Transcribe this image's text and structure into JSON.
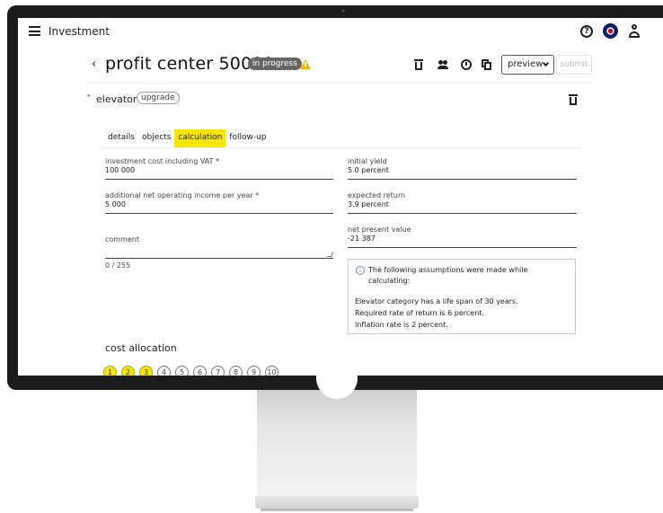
{
  "header": {
    "app_title": "Investment"
  },
  "page": {
    "title": "profit center 50009",
    "status": "in progress",
    "preview_label": "preview",
    "submit_label": "submit"
  },
  "section": {
    "title": "elevator",
    "badge": "upgrade"
  },
  "tabs": [
    {
      "label": "details"
    },
    {
      "label": "objects"
    },
    {
      "label": "calculation",
      "active": true
    },
    {
      "label": "follow-up"
    }
  ],
  "fields": {
    "investment_cost": {
      "label": "investment cost including VAT *",
      "value": "100 000"
    },
    "additional_income": {
      "label": "additional net operating income per year *",
      "value": "5 000"
    },
    "initial_yield": {
      "label": "initial yield",
      "value": "5.0 percent"
    },
    "expected_return": {
      "label": "expected return",
      "value": "3.9 percent"
    },
    "npv": {
      "label": "net present value",
      "value": "-21 387"
    },
    "comment": {
      "label": "comment",
      "counter": "0 / 255"
    }
  },
  "assumptions": {
    "heading": "The following assumptions were made while calculating:",
    "lines": [
      "Elevator category has a life span of 30 years.",
      "Required rate of return is 6 percent.",
      "Inflation rate is 2 percent."
    ]
  },
  "cost_allocation": {
    "title": "cost allocation",
    "steps": [
      {
        "label": "1",
        "done": true
      },
      {
        "label": "2",
        "done": true
      },
      {
        "label": "3",
        "done": true
      },
      {
        "label": "4",
        "done": false
      },
      {
        "label": "5",
        "done": false
      },
      {
        "label": "6",
        "done": false
      },
      {
        "label": "7",
        "done": false
      },
      {
        "label": "8",
        "done": false
      },
      {
        "label": "9",
        "done": false
      },
      {
        "label": "10",
        "done": false
      }
    ]
  },
  "colors": {
    "accent": "#f7e600",
    "badge": "#666666",
    "warning": "#f2b705"
  },
  "icons": [
    "menu-icon",
    "help-icon",
    "language-flag-icon",
    "user-icon",
    "back-icon",
    "warning-icon",
    "trash-icon",
    "people-icon",
    "history-icon",
    "copy-icon",
    "chevron-down-icon",
    "chevron-up-icon",
    "info-icon"
  ]
}
